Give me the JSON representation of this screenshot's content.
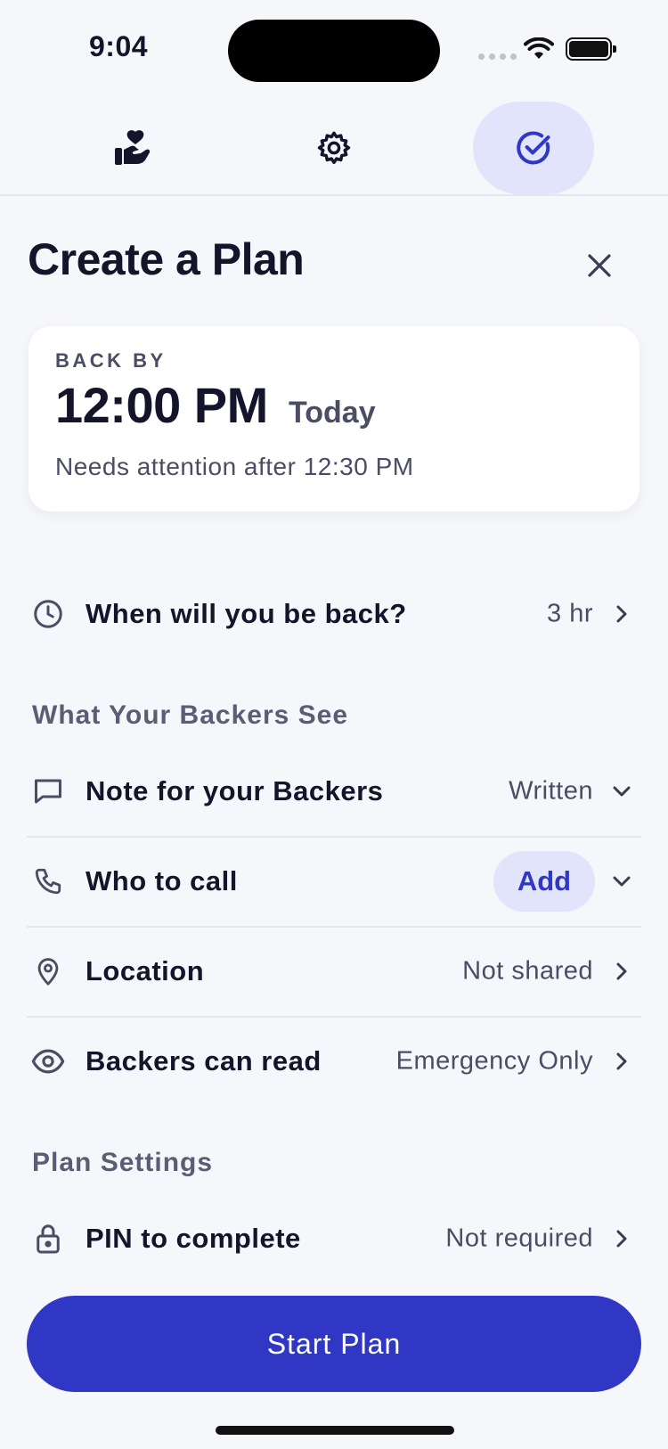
{
  "status_bar": {
    "time": "9:04"
  },
  "tabs": [
    {
      "name": "care",
      "icon": "hand-heart-icon",
      "active": false
    },
    {
      "name": "settings",
      "icon": "gear-icon",
      "active": false
    },
    {
      "name": "plans",
      "icon": "check-circle-icon",
      "active": true
    }
  ],
  "header": {
    "title": "Create a Plan",
    "close_icon": "close-icon"
  },
  "summary": {
    "label": "BACK BY",
    "time": "12:00 PM",
    "day": "Today",
    "note": "Needs attention after 12:30 PM"
  },
  "return_row": {
    "icon": "clock-icon",
    "label": "When will you be back?",
    "value": "3 hr"
  },
  "backers_section": {
    "heading": "What Your Backers See",
    "rows": [
      {
        "icon": "message-icon",
        "label": "Note for your Backers",
        "value": "Written"
      },
      {
        "icon": "phone-icon",
        "label": "Who to call",
        "action": "Add"
      },
      {
        "icon": "map-pin-icon",
        "label": "Location",
        "value": "Not shared"
      },
      {
        "icon": "eye-icon",
        "label": "Backers can read",
        "value": "Emergency Only"
      }
    ]
  },
  "settings_section": {
    "heading": "Plan Settings",
    "rows": [
      {
        "icon": "lock-icon",
        "label": "PIN to complete",
        "value": "Not required"
      }
    ]
  },
  "primary_action": {
    "label": "Start Plan"
  },
  "colors": {
    "accent": "#2f37c4",
    "accent_soft": "#e2e4fb",
    "background": "#f6f7fb",
    "text": "#14142b",
    "muted": "#4a4d63"
  }
}
